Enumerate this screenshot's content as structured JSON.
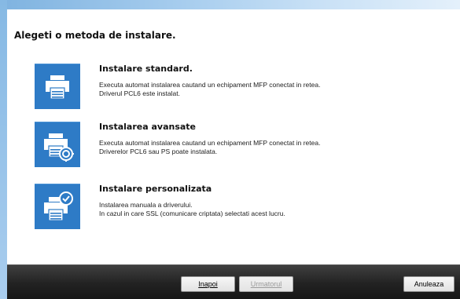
{
  "heading": "Alegeti o metoda de instalare.",
  "options": [
    {
      "title": "Instalare standard.",
      "lines": [
        "Executa automat instalarea cautand un echipament MFP conectat in retea.",
        "Driverul PCL6 este instalat."
      ],
      "icon": "printer-icon"
    },
    {
      "title": "Instalarea avansate",
      "lines": [
        "Executa automat instalarea cautand un echipament MFP conectat in retea.",
        "Driverelor PCL6 sau PS poate instalata."
      ],
      "icon": "printer-gear-icon"
    },
    {
      "title": "Instalare personalizata",
      "lines": [
        "Instalarea manuala a driverului.",
        "In cazul in care SSL (comunicare criptata) selectati acest lucru."
      ],
      "icon": "printer-check-icon"
    }
  ],
  "buttons": {
    "back": "Inapoi",
    "next": "Urmatorul",
    "cancel": "Anuleaza"
  },
  "colors": {
    "tile": "#2e7bc6",
    "bottom_bar": "#222222",
    "window_frame": "#a7cdee"
  }
}
